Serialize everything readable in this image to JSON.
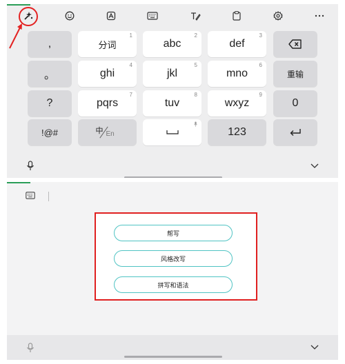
{
  "toolbar": {
    "icons": [
      "ai-write-icon",
      "emoji-icon",
      "ai-image-icon",
      "keyboard-icon",
      "handwriting-icon",
      "clipboard-icon",
      "settings-icon",
      "more-icon"
    ]
  },
  "keys": {
    "row1": {
      "punct": ",",
      "k1": "分词",
      "k1n": "1",
      "k2": "abc",
      "k2n": "2",
      "k3": "def",
      "k3n": "3"
    },
    "row2": {
      "punct": "。",
      "k1": "ghi",
      "k1n": "4",
      "k2": "jkl",
      "k2n": "5",
      "k3": "mno",
      "k3n": "6",
      "action": "重输"
    },
    "row3": {
      "punct": "?",
      "k1": "pqrs",
      "k1n": "7",
      "k2": "tuv",
      "k2n": "8",
      "k3": "wxyz",
      "k3n": "9",
      "action": "0"
    },
    "row4": {
      "symbols": "!@#",
      "lang_zh": "中",
      "lang_en": "En",
      "numbers": "123"
    }
  },
  "ai_panel": {
    "options": [
      "帮写",
      "风格改写",
      "拼写和语法"
    ]
  },
  "colors": {
    "accent_green": "#2a9d57",
    "highlight_red": "#e32222",
    "pill_border": "#4fc3c3"
  }
}
